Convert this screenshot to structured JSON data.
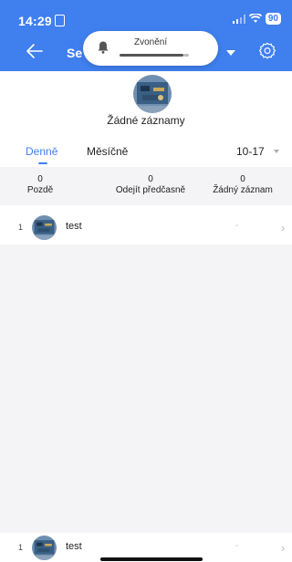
{
  "status_bar": {
    "time": "14:29",
    "battery": "90"
  },
  "header": {
    "title_partial": "Se",
    "settings_icon": "gear-icon",
    "back_icon": "back-arrow-icon"
  },
  "notification_pill": {
    "label": "Zvonění",
    "icon": "bell-icon"
  },
  "profile": {
    "empty_message": "Žádné záznamy"
  },
  "tabs": [
    {
      "label": "Denně",
      "active": true
    },
    {
      "label": "Měsíčně",
      "active": false
    }
  ],
  "date_range": "10-17",
  "stats": {
    "late": {
      "value": "0",
      "label": "Pozdě"
    },
    "left_early": {
      "value": "0",
      "label": "Odejít předčasně"
    },
    "no_record": {
      "value": "0",
      "label": "Žádný záznam"
    }
  },
  "rows": [
    {
      "index": "1",
      "name": "test",
      "value": "-"
    },
    {
      "index": "1",
      "name": "test",
      "value": "-"
    }
  ],
  "colors": {
    "primary": "#3f7fee",
    "background_grey": "#f4f4f6"
  }
}
